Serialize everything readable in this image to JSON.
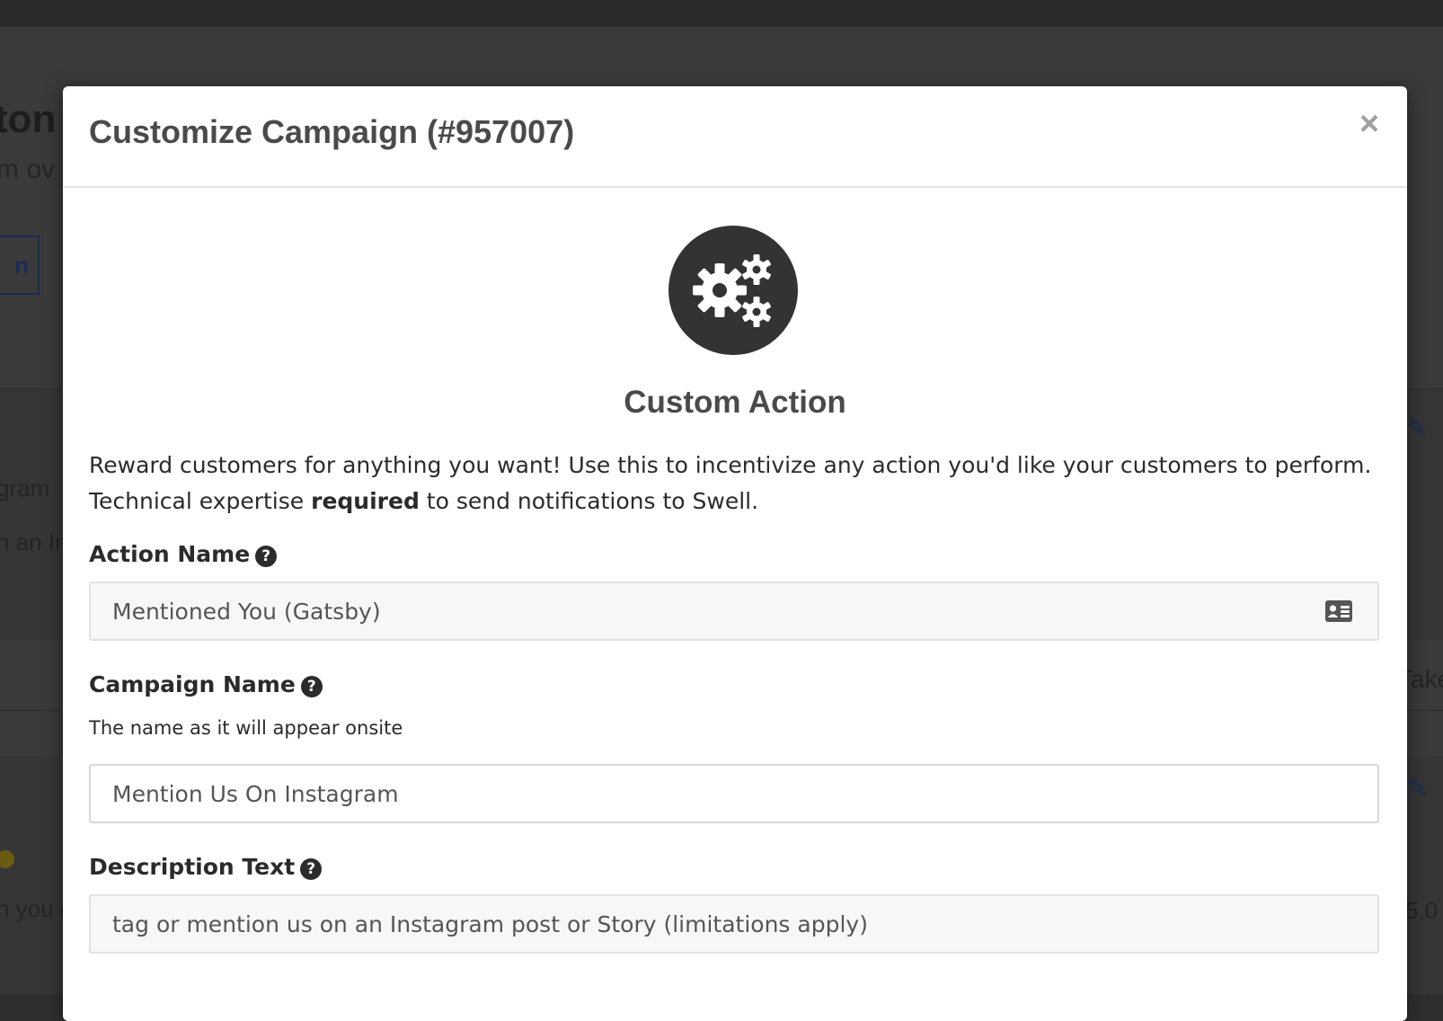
{
  "background": {
    "title_fragment": "ton",
    "subtitle_fragment": "m ov",
    "button_fragment": "n",
    "text_fragment_1": "gram",
    "text_fragment_2": "n an In",
    "text_fragment_3": "n you c",
    "right_fragment_1": "Take",
    "right_fragment_2": "5.0"
  },
  "modal": {
    "title": "Customize Campaign (#957007)",
    "close_label": "×",
    "hero_icon": "gears-icon",
    "hero_title": "Custom Action",
    "intro_text_1": "Reward customers for anything you want! Use this to incentivize any action you'd like your customers to perform. Technical expertise ",
    "intro_bold": "required",
    "intro_text_2": " to send notifications to Swell.",
    "fields": {
      "action_name": {
        "label": "Action Name",
        "value": "Mentioned You (Gatsby)",
        "trailing_icon": "id-card-icon"
      },
      "campaign_name": {
        "label": "Campaign Name",
        "hint": "The name as it will appear onsite",
        "value": "Mention Us On Instagram"
      },
      "description_text": {
        "label": "Description Text",
        "value": "tag or mention us on an Instagram post or Story (limitations apply)"
      }
    },
    "help_glyph": "?"
  },
  "colors": {
    "overlay": "#2f2f2f",
    "modal_bg": "#ffffff",
    "title_text": "#4a4a4a",
    "icon_circle": "#333333",
    "input_bg": "#f7f7f7",
    "accent_navy": "#1a2c56"
  }
}
